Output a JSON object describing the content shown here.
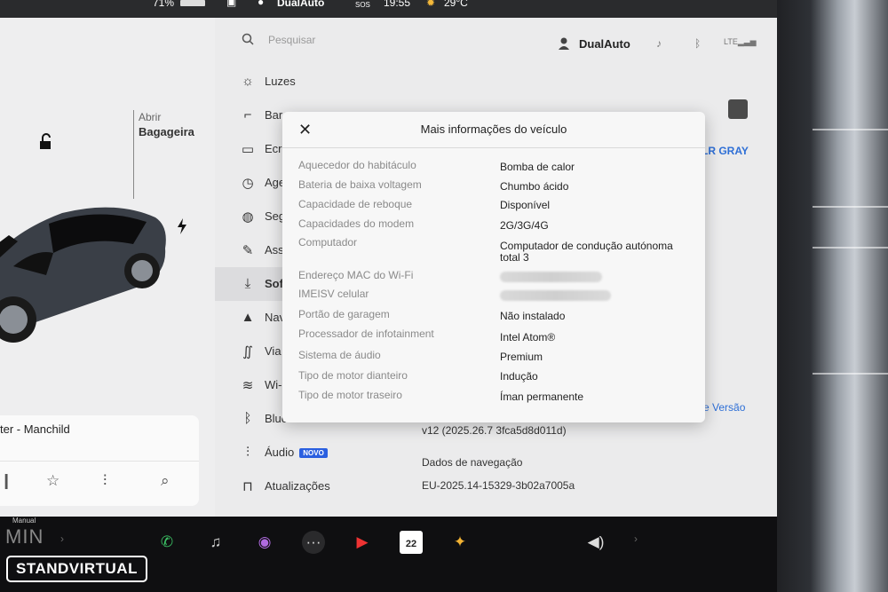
{
  "statusbar": {
    "battery_pct": "71%",
    "user": "DualAuto",
    "sos": "SOS",
    "time": "19:55",
    "temperature": "29°C"
  },
  "car_panel": {
    "trunk_action": "Abrir",
    "trunk_label": "Bagageira",
    "media_track": "ter - Manchild"
  },
  "settings": {
    "search_placeholder": "Pesquisar",
    "user_name": "DualAuto",
    "menu": [
      {
        "label": "Luzes",
        "icon": "sun-icon"
      },
      {
        "label": "Bar",
        "icon": "seat-icon"
      },
      {
        "label": "Ecr",
        "icon": "display-icon"
      },
      {
        "label": "Age",
        "icon": "clock-icon"
      },
      {
        "label": "Seg",
        "icon": "shield-icon"
      },
      {
        "label": "Ass",
        "icon": "wrench-icon"
      },
      {
        "label": "Sof",
        "icon": "download-icon"
      },
      {
        "label": "Nav",
        "icon": "navigation-icon"
      },
      {
        "label": "Via",
        "icon": "trips-icon"
      },
      {
        "label": "Wi-",
        "icon": "wifi-icon"
      },
      {
        "label": "Bluetooth",
        "icon": "bluetooth-icon"
      },
      {
        "label": "Áudio",
        "icon": "sliders-icon",
        "badge": "NOVO"
      },
      {
        "label": "Atualizações",
        "icon": "lock-icon"
      }
    ],
    "paint_link": "LR GRAY",
    "version_link": "e Versão",
    "version_value": "v12 (2025.26.7 3fca5d8d011d)",
    "nav_data_label": "Dados de navegação",
    "nav_data_value": "EU-2025.14-15329-3b02a7005a"
  },
  "modal": {
    "title": "Mais informações do veículo",
    "rows": [
      {
        "label": "Aquecedor do habitáculo",
        "value": "Bomba de calor"
      },
      {
        "label": "Bateria de baixa voltagem",
        "value": "Chumbo ácido"
      },
      {
        "label": "Capacidade de reboque",
        "value": "Disponível"
      },
      {
        "label": "Capacidades do modem",
        "value": "2G/3G/4G"
      },
      {
        "label": "Computador",
        "value": "Computador de condução autónoma",
        "value2": "total 3"
      },
      {
        "label": "Endereço MAC do Wi-Fi",
        "value": ""
      },
      {
        "label": "IMEISV celular",
        "value": ""
      },
      {
        "label": "Portão de garagem",
        "value": "Não instalado"
      },
      {
        "label": "Processador de infotainment",
        "value": "Intel Atom®"
      },
      {
        "label": "Sistema de áudio",
        "value": "Premium"
      },
      {
        "label": "Tipo de motor dianteiro",
        "value": "Indução"
      },
      {
        "label": "Tipo de motor traseiro",
        "value": "Íman permanente"
      }
    ]
  },
  "dock": {
    "gear_mode": "Manual",
    "gear_value": "MIN",
    "calendar_day": "22"
  },
  "watermark": "STANDVIRTUAL",
  "colors": {
    "accent": "#2e6fd6",
    "badge": "#2a5fe0"
  }
}
